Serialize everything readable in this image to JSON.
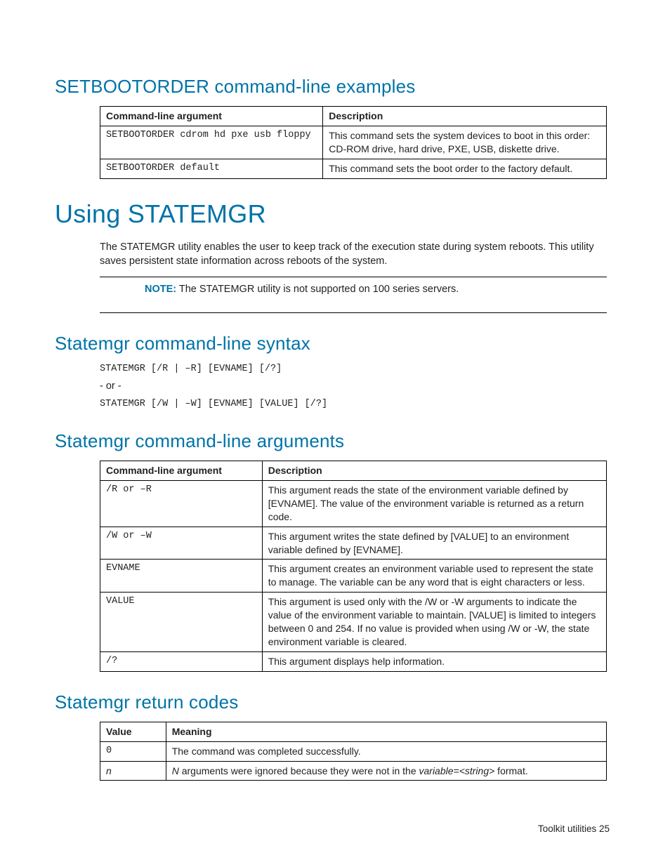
{
  "h_setboot": "SETBOOTORDER command-line examples",
  "tbl1": {
    "h1": "Command-line argument",
    "h2": "Description",
    "rows": [
      {
        "c1": "SETBOOTORDER cdrom hd pxe usb floppy",
        "c2": "This command sets the system devices to boot in this order: CD-ROM drive, hard drive, PXE, USB, diskette drive."
      },
      {
        "c1": "SETBOOTORDER default",
        "c2": "This command sets the boot order to the factory default."
      }
    ]
  },
  "h_using": "Using STATEMGR",
  "intro": "The STATEMGR utility enables the user to keep track of the execution state during system reboots. This utility saves persistent state information across reboots of the system.",
  "note_label": "NOTE:",
  "note_text": " The STATEMGR utility is not supported on 100 series servers.",
  "h_syntax": "Statemgr command-line syntax",
  "syntax1": "STATEMGR [/R | –R] [EVNAME] [/?]",
  "or_sep": "- or -",
  "syntax2": "STATEMGR [/W | –W] [EVNAME] [VALUE] [/?]",
  "h_args": "Statemgr command-line arguments",
  "tbl2": {
    "h1": "Command-line argument",
    "h2": "Description",
    "rows": [
      {
        "c1": "/R or –R",
        "c2": "This argument reads the state of the environment variable defined by [EVNAME]. The value of the environment variable is returned as a return code."
      },
      {
        "c1": "/W or –W",
        "c2": "This argument writes the state defined by [VALUE] to an environment variable defined by [EVNAME]."
      },
      {
        "c1": "EVNAME",
        "c2": "This argument creates an environment variable used to represent the state to manage. The variable can be any word that is eight characters or less."
      },
      {
        "c1": "VALUE",
        "c2": "This argument is used only with the /W or -W arguments to indicate the value of the environment variable to maintain. [VALUE] is limited to integers between 0 and 254. If no value is provided when using /W or -W, the state environment variable is cleared."
      },
      {
        "c1": "/?",
        "c2": "This argument displays help information."
      }
    ]
  },
  "h_retcodes": "Statemgr return codes",
  "tbl3": {
    "h1": "Value",
    "h2": "Meaning",
    "rows": [
      {
        "c1": "0",
        "c2_prefix": "The command was completed successfully."
      },
      {
        "c1": "n",
        "c2_n": "N",
        "c2_mid": " arguments were ignored because they were not in the ",
        "c2_var": "variable=<string>",
        "c2_suf": " format."
      }
    ]
  },
  "footer": "Toolkit utilities   25"
}
